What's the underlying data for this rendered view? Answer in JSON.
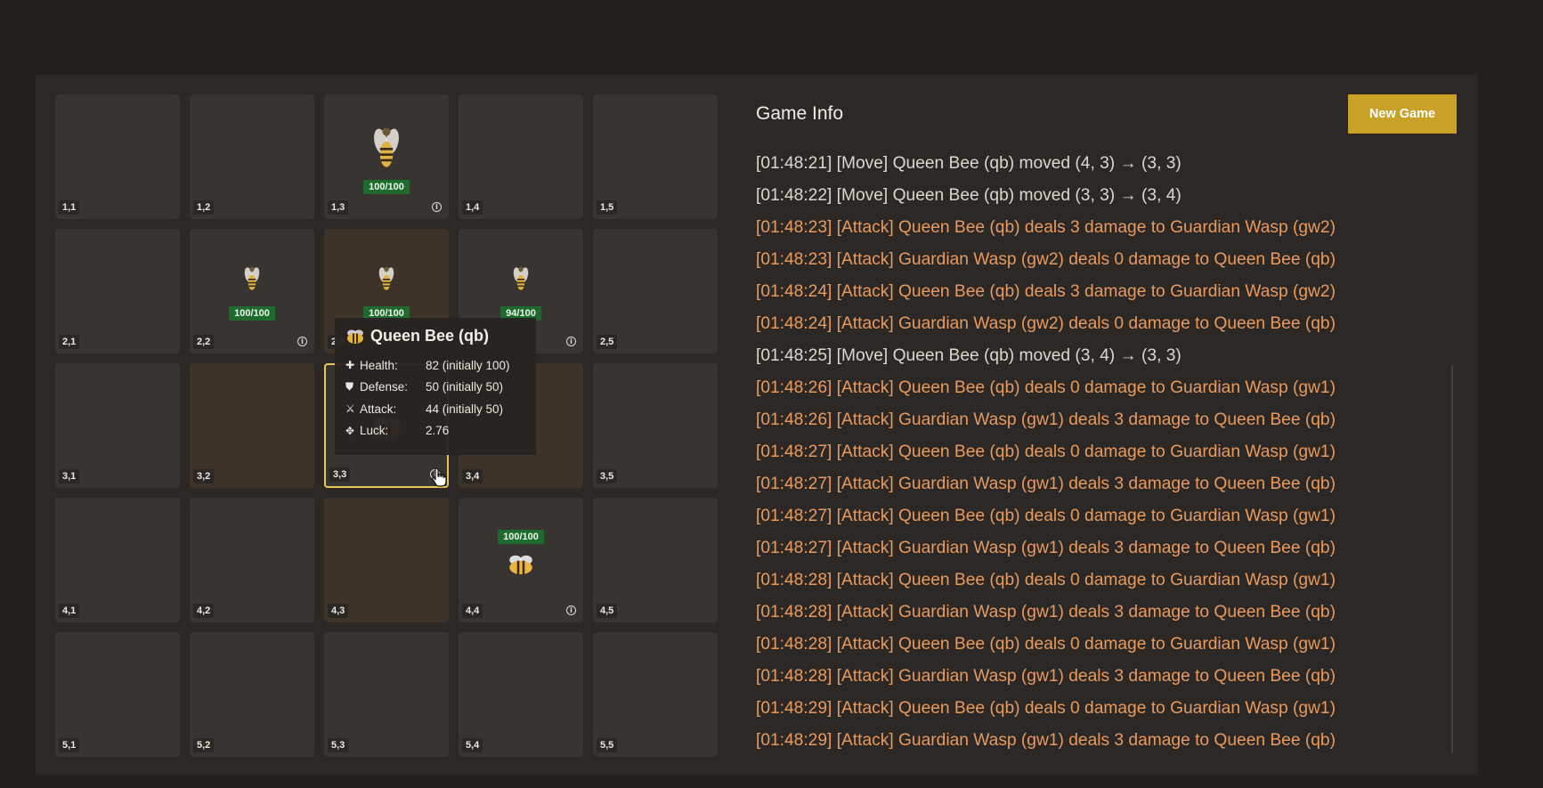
{
  "board": {
    "cells": [
      {
        "coord": "1,1"
      },
      {
        "coord": "1,2"
      },
      {
        "coord": "1,3",
        "unit": "wasp",
        "hp": "100/100",
        "info": true
      },
      {
        "coord": "1,4"
      },
      {
        "coord": "1,5"
      },
      {
        "coord": "2,1"
      },
      {
        "coord": "2,2",
        "unit": "wasp-small",
        "hp": "100/100",
        "info": true
      },
      {
        "coord": "2,3",
        "unit": "wasp-small",
        "hp": "100/100",
        "highlight": true
      },
      {
        "coord": "2,4",
        "unit": "wasp-small",
        "hp": "94/100",
        "info": true
      },
      {
        "coord": "2,5"
      },
      {
        "coord": "3,1"
      },
      {
        "coord": "3,2",
        "highlight": true
      },
      {
        "coord": "3,3",
        "unit": "queen",
        "selected": true,
        "info": true
      },
      {
        "coord": "3,4",
        "highlight": true
      },
      {
        "coord": "3,5"
      },
      {
        "coord": "4,1"
      },
      {
        "coord": "4,2"
      },
      {
        "coord": "4,3",
        "highlight": true
      },
      {
        "coord": "4,4",
        "unit": "bee",
        "hp": "100/100",
        "info": true
      },
      {
        "coord": "4,5"
      },
      {
        "coord": "5,1"
      },
      {
        "coord": "5,2"
      },
      {
        "coord": "5,3"
      },
      {
        "coord": "5,4"
      },
      {
        "coord": "5,5"
      }
    ]
  },
  "tooltip": {
    "title": "Queen Bee (qb)",
    "stats": [
      {
        "icon": "plus-icon",
        "label": "Health:",
        "value": "82 (initially 100)"
      },
      {
        "icon": "shield-icon",
        "label": "Defense:",
        "value": "50 (initially 50)"
      },
      {
        "icon": "sword-icon",
        "label": "Attack:",
        "value": "44 (initially 50)"
      },
      {
        "icon": "move-icon",
        "label": "Luck:",
        "value": "2.76"
      }
    ]
  },
  "info": {
    "title": "Game Info",
    "new_game_label": "New Game"
  },
  "log": [
    {
      "type": "move",
      "text": "[01:48:21] [Move] Queen Bee (qb) moved (4, 3) → (3, 3)"
    },
    {
      "type": "move",
      "text": "[01:48:22] [Move] Queen Bee (qb) moved (3, 3) → (3, 4)"
    },
    {
      "type": "attack",
      "text": "[01:48:23] [Attack] Queen Bee (qb) deals 3 damage to Guardian Wasp (gw2)"
    },
    {
      "type": "attack",
      "text": "[01:48:23] [Attack] Guardian Wasp (gw2) deals 0 damage to Queen Bee (qb)"
    },
    {
      "type": "attack",
      "text": "[01:48:24] [Attack] Queen Bee (qb) deals 3 damage to Guardian Wasp (gw2)"
    },
    {
      "type": "attack",
      "text": "[01:48:24] [Attack] Guardian Wasp (gw2) deals 0 damage to Queen Bee (qb)"
    },
    {
      "type": "move",
      "text": "[01:48:25] [Move] Queen Bee (qb) moved (3, 4) → (3, 3)"
    },
    {
      "type": "attack",
      "text": "[01:48:26] [Attack] Queen Bee (qb) deals 0 damage to Guardian Wasp (gw1)"
    },
    {
      "type": "attack",
      "text": "[01:48:26] [Attack] Guardian Wasp (gw1) deals 3 damage to Queen Bee (qb)"
    },
    {
      "type": "attack",
      "text": "[01:48:27] [Attack] Queen Bee (qb) deals 0 damage to Guardian Wasp (gw1)"
    },
    {
      "type": "attack",
      "text": "[01:48:27] [Attack] Guardian Wasp (gw1) deals 3 damage to Queen Bee (qb)"
    },
    {
      "type": "attack",
      "text": "[01:48:27] [Attack] Queen Bee (qb) deals 0 damage to Guardian Wasp (gw1)"
    },
    {
      "type": "attack",
      "text": "[01:48:27] [Attack] Guardian Wasp (gw1) deals 3 damage to Queen Bee (qb)"
    },
    {
      "type": "attack",
      "text": "[01:48:28] [Attack] Queen Bee (qb) deals 0 damage to Guardian Wasp (gw1)"
    },
    {
      "type": "attack",
      "text": "[01:48:28] [Attack] Guardian Wasp (gw1) deals 3 damage to Queen Bee (qb)"
    },
    {
      "type": "attack",
      "text": "[01:48:28] [Attack] Queen Bee (qb) deals 0 damage to Guardian Wasp (gw1)"
    },
    {
      "type": "attack",
      "text": "[01:48:28] [Attack] Guardian Wasp (gw1) deals 3 damage to Queen Bee (qb)"
    },
    {
      "type": "attack",
      "text": "[01:48:29] [Attack] Queen Bee (qb) deals 0 damage to Guardian Wasp (gw1)"
    },
    {
      "type": "attack",
      "text": "[01:48:29] [Attack] Guardian Wasp (gw1) deals 3 damage to Queen Bee (qb)"
    }
  ]
}
